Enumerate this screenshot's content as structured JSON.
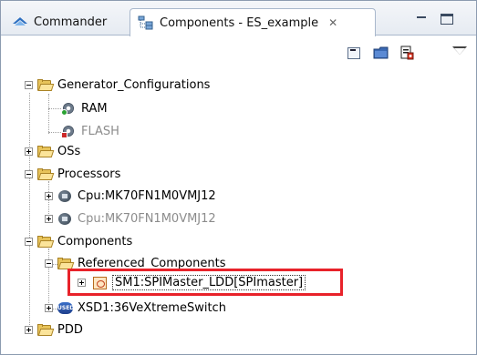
{
  "tabs": [
    {
      "label": "Commander",
      "icon": "commander-icon",
      "active": false
    },
    {
      "label": "Components - ES_example",
      "icon": "components-icon",
      "active": true,
      "close": "✕"
    }
  ],
  "tree": {
    "generator": {
      "label": "Generator_Configurations",
      "children": [
        {
          "label": "RAM"
        },
        {
          "label": "FLASH"
        }
      ]
    },
    "oss": {
      "label": "OSs"
    },
    "processors": {
      "label": "Processors",
      "children": [
        {
          "label": "Cpu:MK70FN1M0VMJ12"
        },
        {
          "label": "Cpu:MK70FN1M0VMJ12"
        }
      ]
    },
    "components": {
      "label": "Components",
      "children": [
        {
          "label": "Referenced_Components"
        },
        {
          "label": "SM1:SPIMaster_LDD[SPImaster]"
        },
        {
          "label": "XSD1:36VeXtremeSwitch"
        }
      ]
    },
    "pdd": {
      "label": "PDD"
    }
  },
  "icon_badge_used": "USED",
  "colors": {
    "highlight": "#e8222a",
    "dim_text": "#8c8c8c",
    "folder": "#e7c35a"
  }
}
